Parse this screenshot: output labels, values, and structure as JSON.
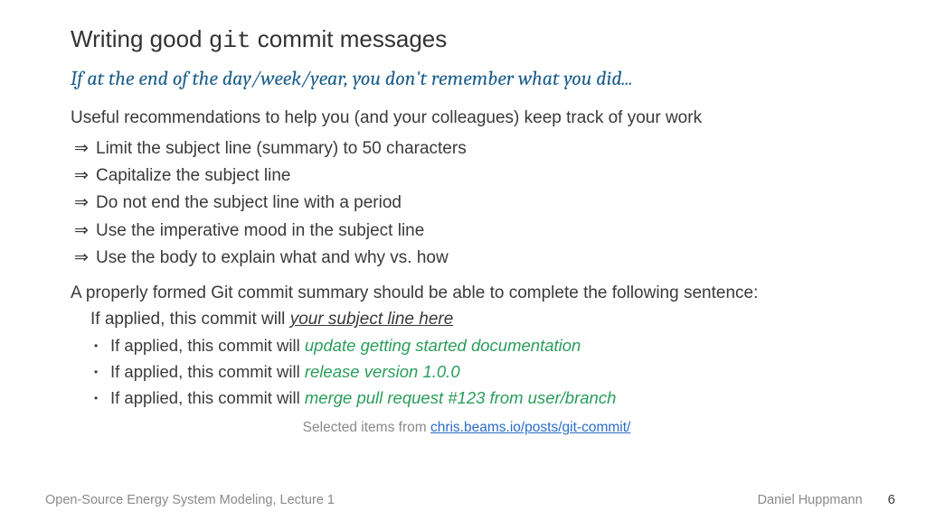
{
  "title": {
    "pre": "Writing good ",
    "mono": "git",
    "post": " commit messages"
  },
  "subtitle": "If at the end of the day/week/year, you don't remember what you did...",
  "intro": "Useful recommendations to help you (and your colleagues) keep track of your work",
  "rules": [
    "Limit the subject line (summary) to 50 characters",
    "Capitalize the subject line",
    "Do not end the subject line with a period",
    "Use the imperative mood in the subject line",
    "Use the body to explain what and why vs. how"
  ],
  "sentence_intro": "A properly formed Git commit summary should be able to complete the following sentence:",
  "completion_prefix": "If applied, this commit will ",
  "completion_placeholder": "your subject line here",
  "examples_prefix": "If applied, this commit will ",
  "examples": [
    "update getting started documentation",
    "release version 1.0.0",
    "merge pull request #123 from user/branch"
  ],
  "source_label": "Selected items from ",
  "source_link": "chris.beams.io/posts/git-commit/",
  "footer": {
    "left": "Open-Source Energy System Modeling, Lecture 1",
    "author": "Daniel Huppmann",
    "page": "6"
  }
}
